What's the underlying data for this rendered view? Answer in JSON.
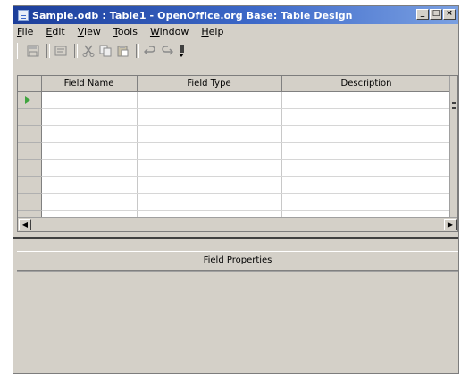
{
  "window": {
    "title": "Sample.odb : Table1 - OpenOffice.org Base: Table Design",
    "controls": [
      "_",
      "□",
      "×"
    ]
  },
  "menu": [
    {
      "key": "F",
      "rest": "ile"
    },
    {
      "key": "E",
      "rest": "dit"
    },
    {
      "key": "V",
      "rest": "iew"
    },
    {
      "key": "T",
      "rest": "ools"
    },
    {
      "key": "W",
      "rest": "indow"
    },
    {
      "key": "H",
      "rest": "elp"
    }
  ],
  "toolbar": {
    "icons": [
      "save-icon",
      "edit-icon",
      "cut-icon",
      "copy-icon",
      "paste-icon",
      "undo-icon",
      "redo-icon",
      "more-icon"
    ]
  },
  "grid": {
    "columns": [
      "Field Name",
      "Field Type",
      "Description"
    ],
    "rows": 8,
    "active_row": 0
  },
  "properties": {
    "title": "Field Properties"
  },
  "colors": {
    "title_bar_start": "#1c3e9a",
    "title_bar_end": "#7aa0e2",
    "chrome": "#d4d0c8",
    "row_indicator": "#3fa43f"
  }
}
